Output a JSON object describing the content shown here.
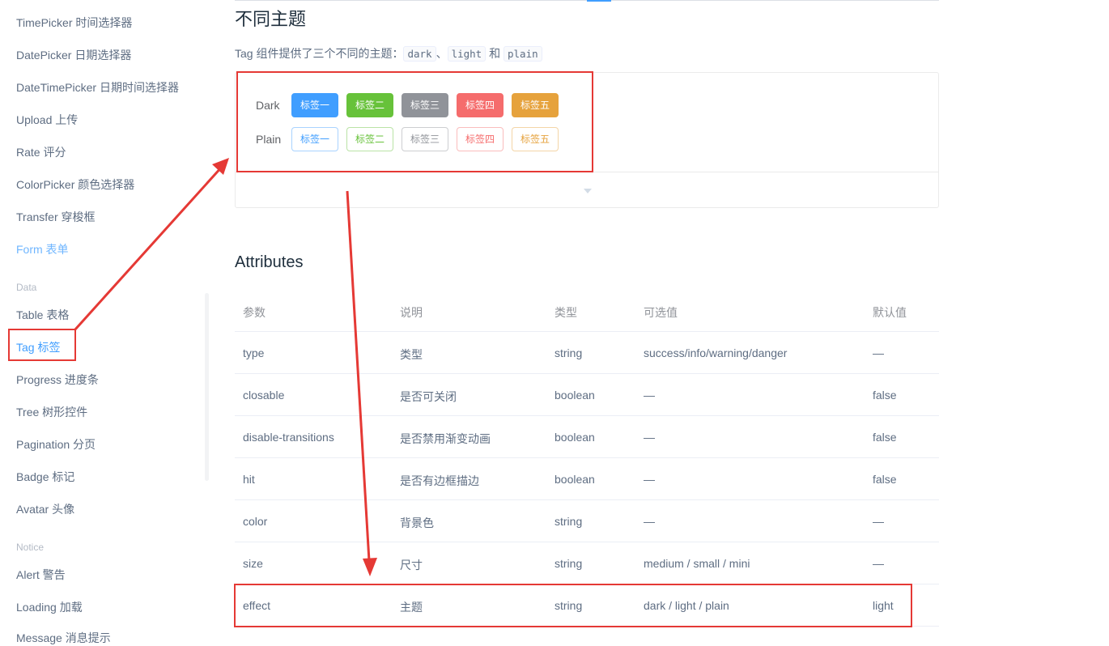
{
  "sidebar": {
    "items": [
      "TimePicker 时间选择器",
      "DatePicker 日期选择器",
      "DateTimePicker 日期时间选择器",
      "Upload 上传",
      "Rate 评分",
      "ColorPicker 颜色选择器",
      "Transfer 穿梭框",
      "Form 表单"
    ],
    "group_data": "Data",
    "data_items": [
      "Table 表格",
      "Tag 标签",
      "Progress 进度条",
      "Tree 树形控件",
      "Pagination 分页",
      "Badge 标记",
      "Avatar 头像"
    ],
    "group_notice": "Notice",
    "notice_items": [
      "Alert 警告",
      "Loading 加载",
      "Message 消息提示"
    ]
  },
  "section": {
    "title": "不同主题",
    "desc_prefix": "Tag 组件提供了三个不同的主题：",
    "code1": "dark",
    "sep1": "、",
    "code2": "light",
    "sep2": "和",
    "code3": "plain"
  },
  "demo": {
    "dark_label": "Dark",
    "plain_label": "Plain",
    "tags": [
      "标签一",
      "标签二",
      "标签三",
      "标签四",
      "标签五"
    ],
    "colors": [
      "#409eff",
      "#67c23a",
      "#909399",
      "#f56c6c",
      "#e6a23c"
    ]
  },
  "attributes": {
    "title": "Attributes",
    "headers": [
      "参数",
      "说明",
      "类型",
      "可选值",
      "默认值"
    ],
    "rows": [
      [
        "type",
        "类型",
        "string",
        "success/info/warning/danger",
        "—"
      ],
      [
        "closable",
        "是否可关闭",
        "boolean",
        "—",
        "false"
      ],
      [
        "disable-transitions",
        "是否禁用渐变动画",
        "boolean",
        "—",
        "false"
      ],
      [
        "hit",
        "是否有边框描边",
        "boolean",
        "—",
        "false"
      ],
      [
        "color",
        "背景色",
        "string",
        "—",
        "—"
      ],
      [
        "size",
        "尺寸",
        "string",
        "medium / small / mini",
        "—"
      ],
      [
        "effect",
        "主题",
        "string",
        "dark / light / plain",
        "light"
      ]
    ]
  },
  "annotation_color": "#e53935"
}
